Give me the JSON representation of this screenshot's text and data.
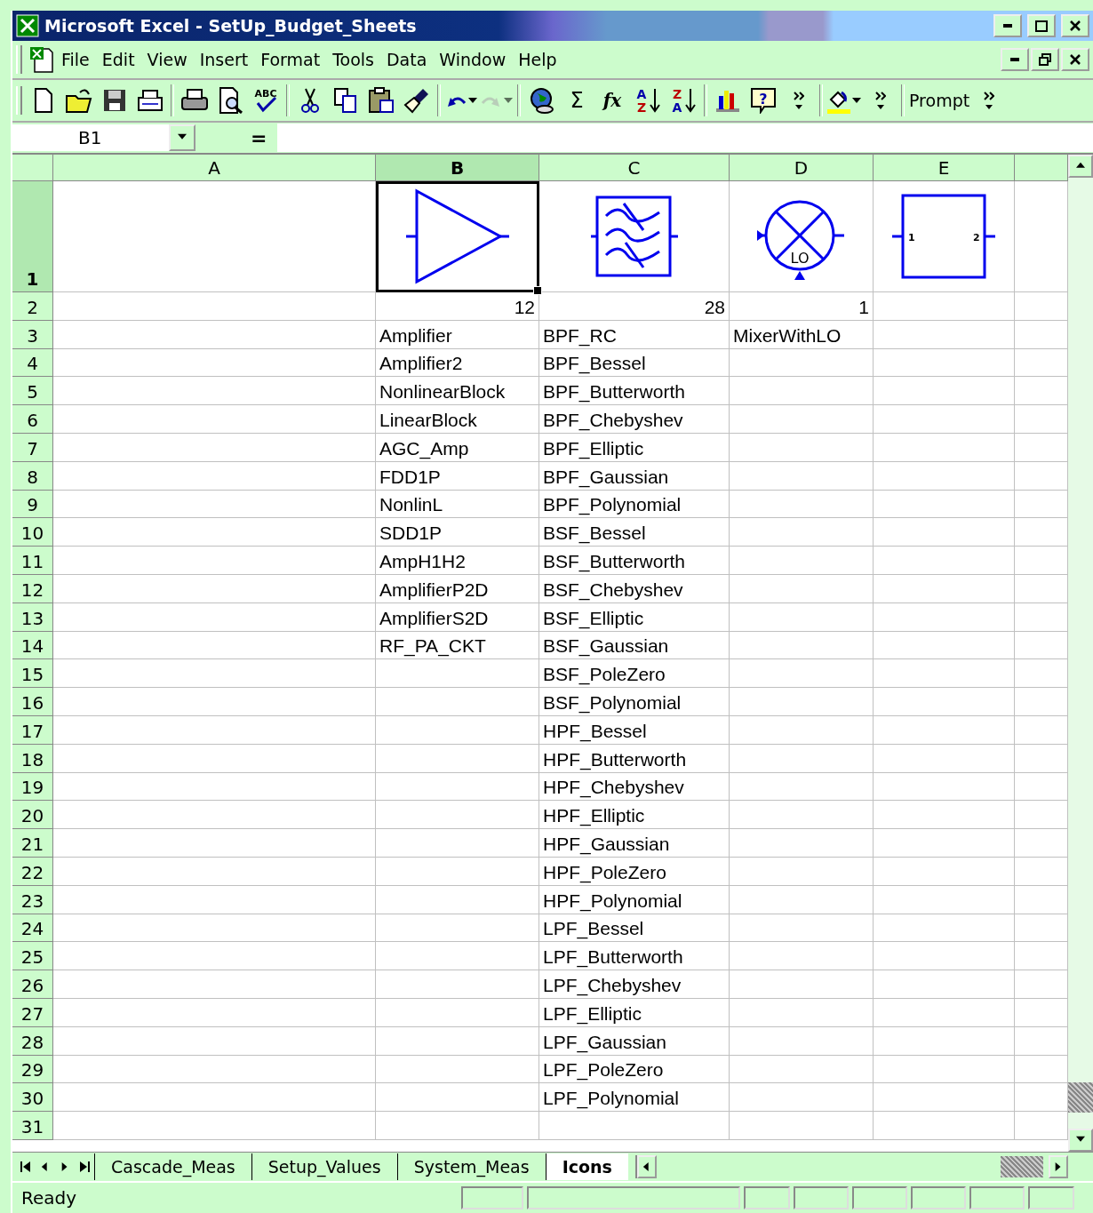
{
  "window": {
    "title": "Microsoft Excel - SetUp_Budget_Sheets"
  },
  "menu": [
    {
      "label": "File"
    },
    {
      "label": "Edit"
    },
    {
      "label": "View"
    },
    {
      "label": "Insert"
    },
    {
      "label": "Format"
    },
    {
      "label": "Tools"
    },
    {
      "label": "Data"
    },
    {
      "label": "Window"
    },
    {
      "label": "Help"
    }
  ],
  "toolbar": [
    {
      "kind": "new"
    },
    {
      "kind": "open"
    },
    {
      "kind": "save"
    },
    {
      "kind": "mail"
    },
    {
      "kind": "separator"
    },
    {
      "kind": "print"
    },
    {
      "kind": "preview"
    },
    {
      "kind": "spelling",
      "text": "ABC"
    },
    {
      "kind": "separator"
    },
    {
      "kind": "cut"
    },
    {
      "kind": "copy"
    },
    {
      "kind": "paste"
    },
    {
      "kind": "brush"
    },
    {
      "kind": "separator"
    },
    {
      "kind": "undo"
    },
    {
      "kind": "redo",
      "disabled": true
    },
    {
      "kind": "separator"
    },
    {
      "kind": "web"
    },
    {
      "kind": "sum",
      "text": "Σ"
    },
    {
      "kind": "function",
      "text": "fx"
    },
    {
      "kind": "sort",
      "text": "A",
      "text2": "Z"
    },
    {
      "kind": "sort",
      "text": "Z",
      "text2": "A"
    },
    {
      "kind": "separator"
    },
    {
      "kind": "chart"
    },
    {
      "kind": "help",
      "text": "?"
    },
    {
      "kind": "more"
    },
    {
      "kind": "separator"
    },
    {
      "kind": "fill"
    },
    {
      "kind": "more"
    },
    {
      "kind": "separator"
    },
    {
      "kind": "label",
      "text": "Prompt"
    },
    {
      "kind": "more"
    }
  ],
  "formula_bar": {
    "name_box": "B1",
    "equals": "="
  },
  "columns": [
    {
      "label": "A",
      "selected": false
    },
    {
      "label": "B",
      "selected": true
    },
    {
      "label": "C",
      "selected": false
    },
    {
      "label": "D",
      "selected": false
    },
    {
      "label": "E",
      "selected": false
    }
  ],
  "rows": [
    {
      "header": "1",
      "selected": true,
      "symbols": [
        {
          "kind": "amplifier"
        },
        {
          "kind": "filter"
        },
        {
          "kind": "mixer",
          "label": "LO"
        },
        {
          "kind": "block",
          "label": "1",
          "label2": "2"
        }
      ]
    },
    {
      "header": "2",
      "selected": false,
      "cells": [
        {
          "kind": "empty"
        },
        {
          "kind": "number",
          "text": "12"
        },
        {
          "kind": "number",
          "text": "28"
        },
        {
          "kind": "number",
          "text": "1"
        }
      ]
    },
    {
      "header": "3",
      "selected": false,
      "cells": [
        {
          "kind": "empty"
        },
        {
          "kind": "text",
          "text": "Amplifier"
        },
        {
          "kind": "text",
          "text": "BPF_RC"
        },
        {
          "kind": "text",
          "text": "MixerWithLO"
        }
      ]
    },
    {
      "header": "4",
      "selected": false,
      "cells": [
        {
          "kind": "empty"
        },
        {
          "kind": "text",
          "text": "Amplifier2"
        },
        {
          "kind": "text",
          "text": "BPF_Bessel"
        }
      ]
    },
    {
      "header": "5",
      "selected": false,
      "cells": [
        {
          "kind": "empty"
        },
        {
          "kind": "text",
          "text": "NonlinearBlock"
        },
        {
          "kind": "text",
          "text": "BPF_Butterworth"
        }
      ]
    },
    {
      "header": "6",
      "selected": false,
      "cells": [
        {
          "kind": "empty"
        },
        {
          "kind": "text",
          "text": "LinearBlock"
        },
        {
          "kind": "text",
          "text": "BPF_Chebyshev"
        }
      ]
    },
    {
      "header": "7",
      "selected": false,
      "cells": [
        {
          "kind": "empty"
        },
        {
          "kind": "text",
          "text": "AGC_Amp"
        },
        {
          "kind": "text",
          "text": "BPF_Elliptic"
        }
      ]
    },
    {
      "header": "8",
      "selected": false,
      "cells": [
        {
          "kind": "empty"
        },
        {
          "kind": "text",
          "text": "FDD1P"
        },
        {
          "kind": "text",
          "text": "BPF_Gaussian"
        }
      ]
    },
    {
      "header": "9",
      "selected": false,
      "cells": [
        {
          "kind": "empty"
        },
        {
          "kind": "text",
          "text": "NonlinL"
        },
        {
          "kind": "text",
          "text": "BPF_Polynomial"
        }
      ]
    },
    {
      "header": "10",
      "selected": false,
      "cells": [
        {
          "kind": "empty"
        },
        {
          "kind": "text",
          "text": "SDD1P"
        },
        {
          "kind": "text",
          "text": "BSF_Bessel"
        }
      ]
    },
    {
      "header": "11",
      "selected": false,
      "cells": [
        {
          "kind": "empty"
        },
        {
          "kind": "text",
          "text": "AmpH1H2"
        },
        {
          "kind": "text",
          "text": "BSF_Butterworth"
        }
      ]
    },
    {
      "header": "12",
      "selected": false,
      "cells": [
        {
          "kind": "empty"
        },
        {
          "kind": "text",
          "text": "AmplifierP2D"
        },
        {
          "kind": "text",
          "text": "BSF_Chebyshev"
        }
      ]
    },
    {
      "header": "13",
      "selected": false,
      "cells": [
        {
          "kind": "empty"
        },
        {
          "kind": "text",
          "text": "AmplifierS2D"
        },
        {
          "kind": "text",
          "text": "BSF_Elliptic"
        }
      ]
    },
    {
      "header": "14",
      "selected": false,
      "cells": [
        {
          "kind": "empty"
        },
        {
          "kind": "text",
          "text": "RF_PA_CKT"
        },
        {
          "kind": "text",
          "text": "BSF_Gaussian"
        }
      ]
    },
    {
      "header": "15",
      "selected": false,
      "cells": [
        {
          "kind": "empty"
        },
        {
          "kind": "empty"
        },
        {
          "kind": "text",
          "text": "BSF_PoleZero"
        }
      ]
    },
    {
      "header": "16",
      "selected": false,
      "cells": [
        {
          "kind": "empty"
        },
        {
          "kind": "empty"
        },
        {
          "kind": "text",
          "text": "BSF_Polynomial"
        }
      ]
    },
    {
      "header": "17",
      "selected": false,
      "cells": [
        {
          "kind": "empty"
        },
        {
          "kind": "empty"
        },
        {
          "kind": "text",
          "text": "HPF_Bessel"
        }
      ]
    },
    {
      "header": "18",
      "selected": false,
      "cells": [
        {
          "kind": "empty"
        },
        {
          "kind": "empty"
        },
        {
          "kind": "text",
          "text": "HPF_Butterworth"
        }
      ]
    },
    {
      "header": "19",
      "selected": false,
      "cells": [
        {
          "kind": "empty"
        },
        {
          "kind": "empty"
        },
        {
          "kind": "text",
          "text": "HPF_Chebyshev"
        }
      ]
    },
    {
      "header": "20",
      "selected": false,
      "cells": [
        {
          "kind": "empty"
        },
        {
          "kind": "empty"
        },
        {
          "kind": "text",
          "text": "HPF_Elliptic"
        }
      ]
    },
    {
      "header": "21",
      "selected": false,
      "cells": [
        {
          "kind": "empty"
        },
        {
          "kind": "empty"
        },
        {
          "kind": "text",
          "text": "HPF_Gaussian"
        }
      ]
    },
    {
      "header": "22",
      "selected": false,
      "cells": [
        {
          "kind": "empty"
        },
        {
          "kind": "empty"
        },
        {
          "kind": "text",
          "text": "HPF_PoleZero"
        }
      ]
    },
    {
      "header": "23",
      "selected": false,
      "cells": [
        {
          "kind": "empty"
        },
        {
          "kind": "empty"
        },
        {
          "kind": "text",
          "text": "HPF_Polynomial"
        }
      ]
    },
    {
      "header": "24",
      "selected": false,
      "cells": [
        {
          "kind": "empty"
        },
        {
          "kind": "empty"
        },
        {
          "kind": "text",
          "text": "LPF_Bessel"
        }
      ]
    },
    {
      "header": "25",
      "selected": false,
      "cells": [
        {
          "kind": "empty"
        },
        {
          "kind": "empty"
        },
        {
          "kind": "text",
          "text": "LPF_Butterworth"
        }
      ]
    },
    {
      "header": "26",
      "selected": false,
      "cells": [
        {
          "kind": "empty"
        },
        {
          "kind": "empty"
        },
        {
          "kind": "text",
          "text": "LPF_Chebyshev"
        }
      ]
    },
    {
      "header": "27",
      "selected": false,
      "cells": [
        {
          "kind": "empty"
        },
        {
          "kind": "empty"
        },
        {
          "kind": "text",
          "text": "LPF_Elliptic"
        }
      ]
    },
    {
      "header": "28",
      "selected": false,
      "cells": [
        {
          "kind": "empty"
        },
        {
          "kind": "empty"
        },
        {
          "kind": "text",
          "text": "LPF_Gaussian"
        }
      ]
    },
    {
      "header": "29",
      "selected": false,
      "cells": [
        {
          "kind": "empty"
        },
        {
          "kind": "empty"
        },
        {
          "kind": "text",
          "text": "LPF_PoleZero"
        }
      ]
    },
    {
      "header": "30",
      "selected": false,
      "cells": [
        {
          "kind": "empty"
        },
        {
          "kind": "empty"
        },
        {
          "kind": "text",
          "text": "LPF_Polynomial"
        }
      ]
    },
    {
      "header": "31",
      "selected": false
    }
  ],
  "sheet_tabs": [
    {
      "label": "Cascade_Meas",
      "selected": false
    },
    {
      "label": "Setup_Values",
      "selected": false
    },
    {
      "label": "System_Meas",
      "selected": false
    },
    {
      "label": "Icons",
      "selected": true
    }
  ],
  "status_bar": {
    "text": "Ready"
  }
}
